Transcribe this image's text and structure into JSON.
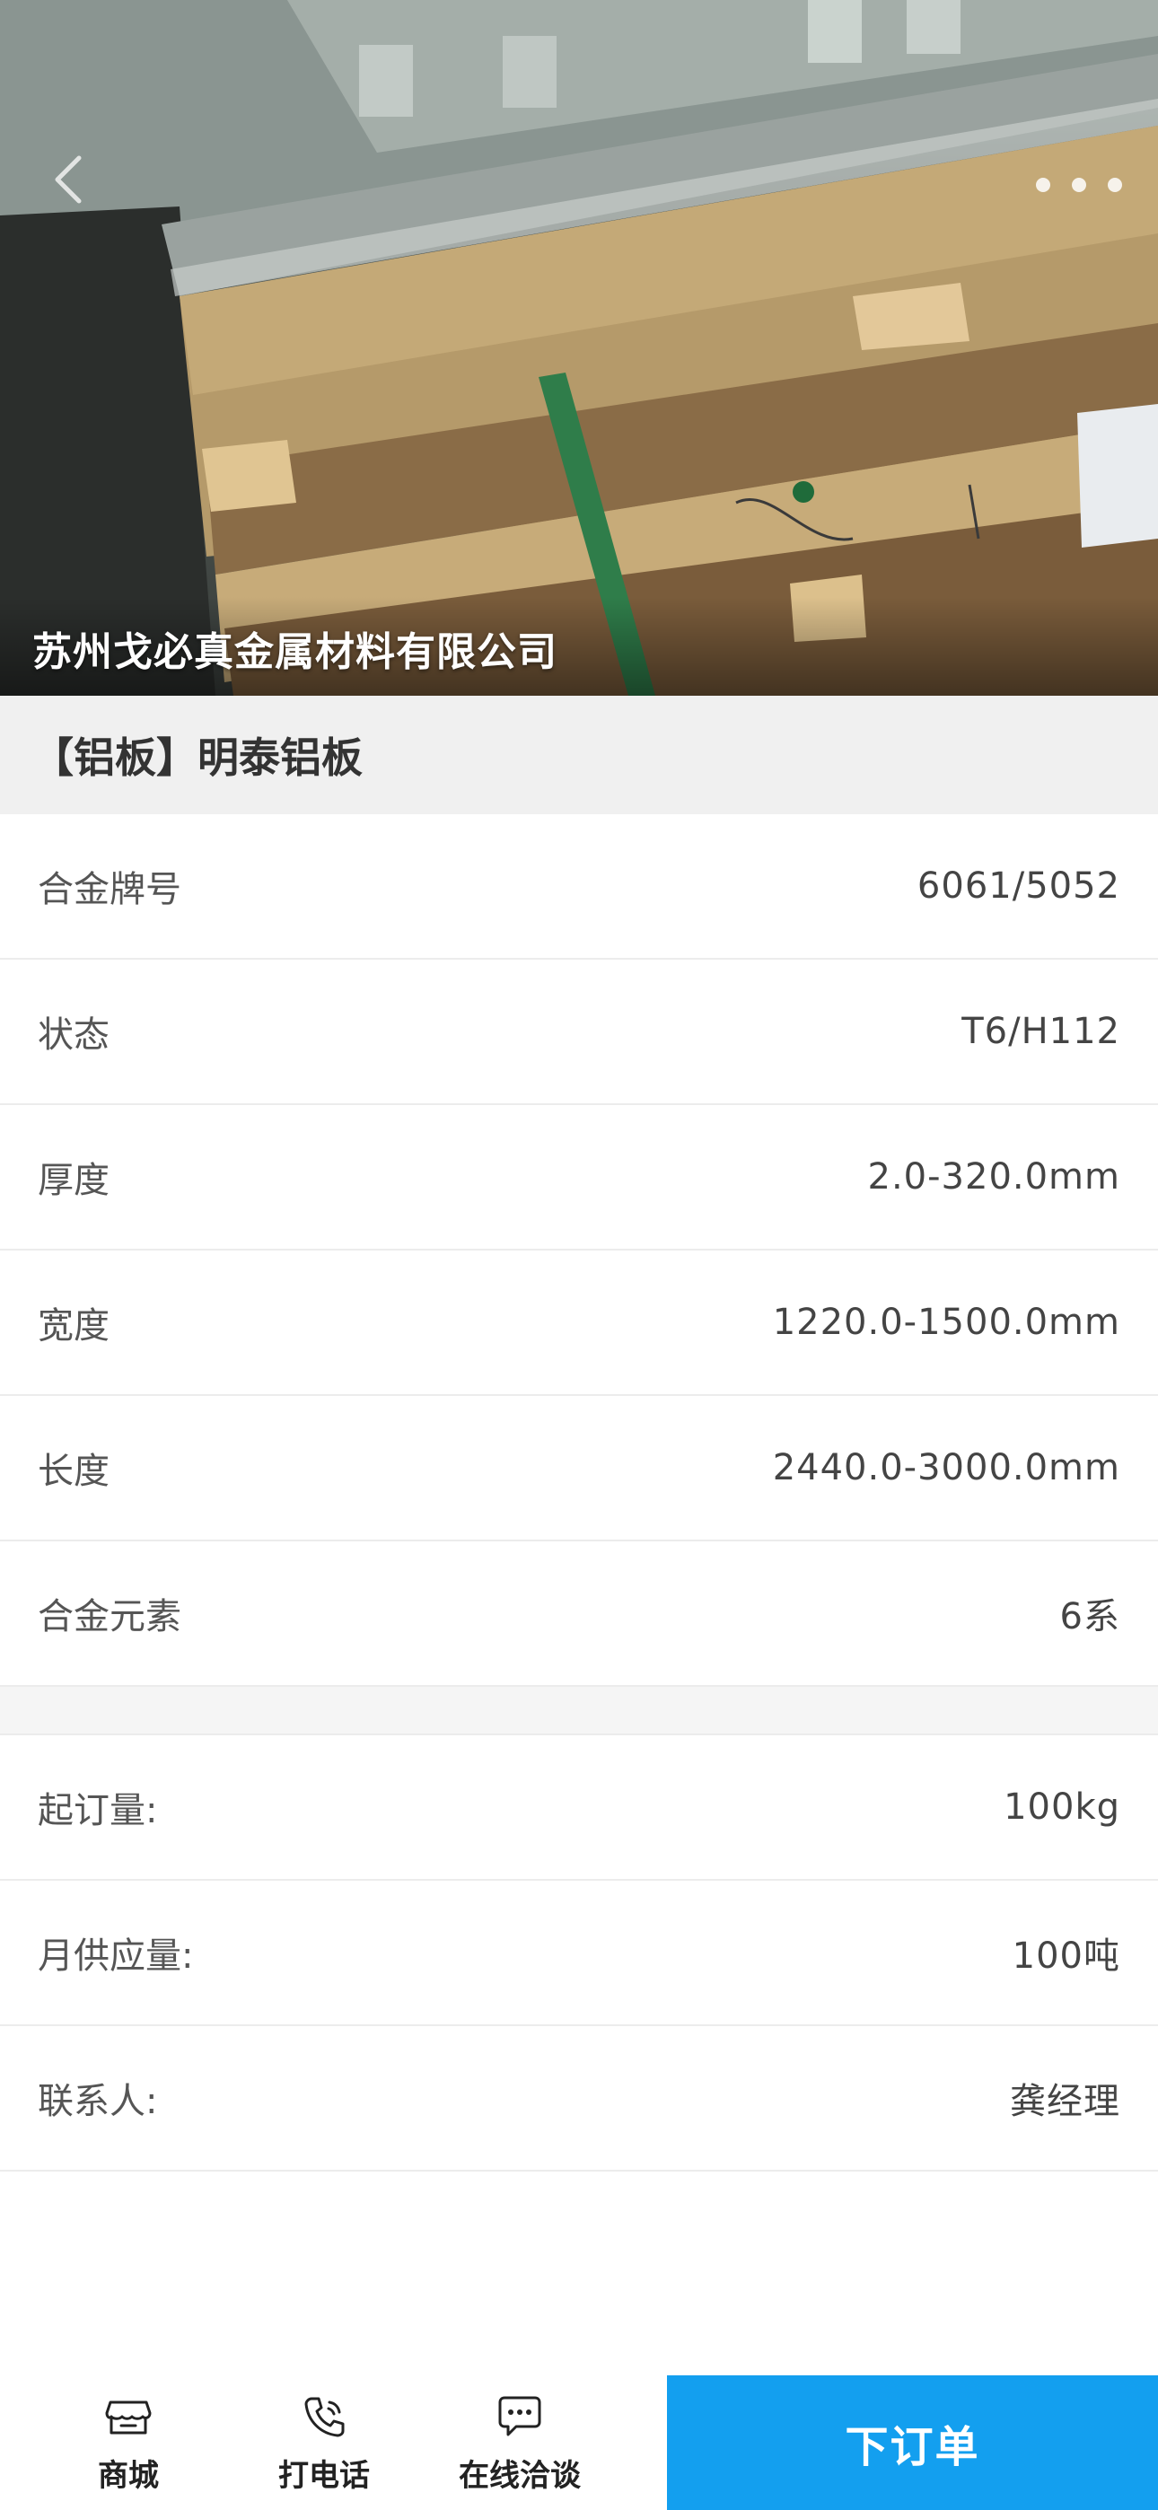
{
  "hero": {
    "company_name": "苏州戈必真金属材料有限公司"
  },
  "product": {
    "title": "【铝板】明泰铝板"
  },
  "specs": [
    {
      "label": "合金牌号",
      "value": "6061/5052"
    },
    {
      "label": "状态",
      "value": "T6/H112"
    },
    {
      "label": "厚度",
      "value": "2.0-320.0mm"
    },
    {
      "label": "宽度",
      "value": "1220.0-1500.0mm"
    },
    {
      "label": "长度",
      "value": "2440.0-3000.0mm"
    },
    {
      "label": "合金元素",
      "value": "6系"
    }
  ],
  "info": [
    {
      "label": "起订量:",
      "value": "100kg"
    },
    {
      "label": "月供应量:",
      "value": "100吨"
    },
    {
      "label": "联系人:",
      "value": "龚经理"
    }
  ],
  "bottom_bar": {
    "shop_label": "商城",
    "call_label": "打电话",
    "chat_label": "在线洽谈",
    "order_label": "下订单"
  },
  "icons": {
    "back": "chevron-left-icon",
    "more": "more-dots-icon",
    "shop": "storefront-icon",
    "call": "phone-icon",
    "chat": "chat-bubble-icon"
  },
  "colors": {
    "accent": "#139fef",
    "title_bg": "#f0f0f0",
    "divider": "#ececec"
  }
}
